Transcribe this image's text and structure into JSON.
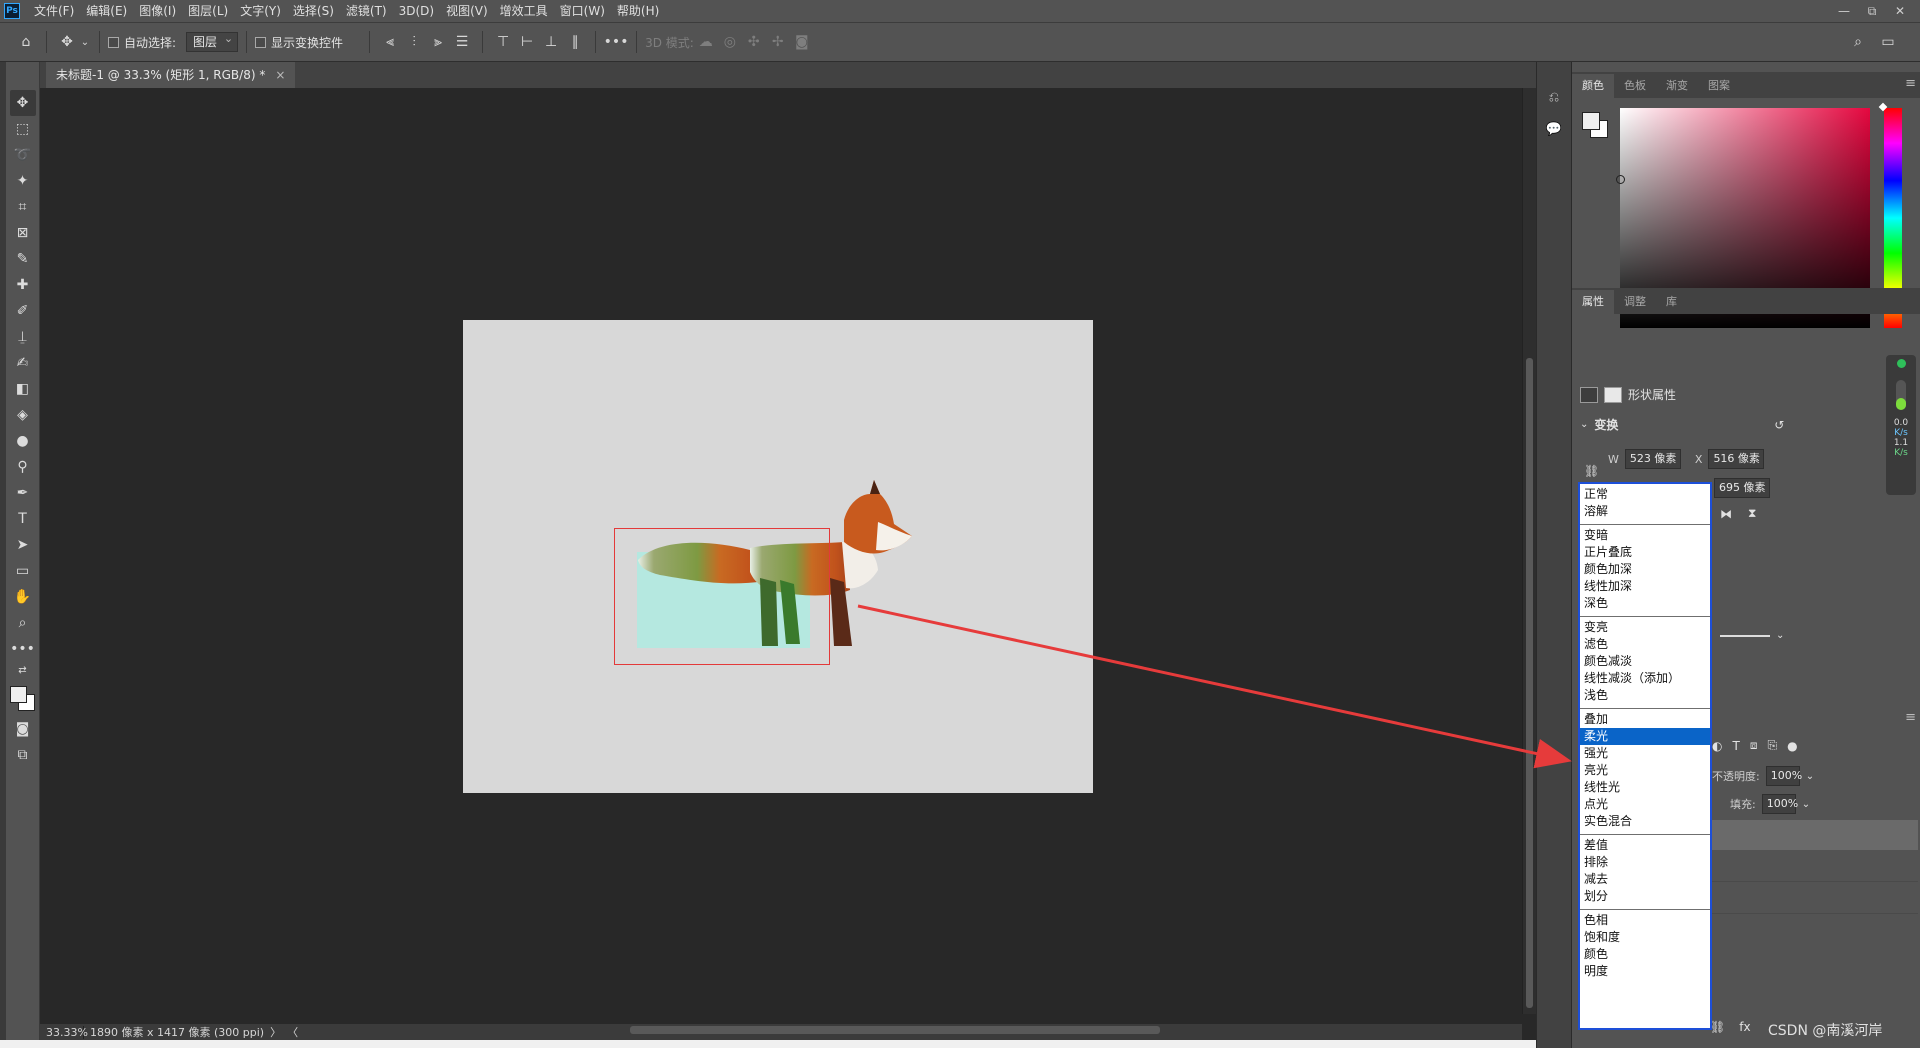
{
  "app": {
    "logo_text": "Ps"
  },
  "menubar": {
    "items": [
      "文件(F)",
      "编辑(E)",
      "图像(I)",
      "图层(L)",
      "文字(Y)",
      "选择(S)",
      "滤镜(T)",
      "3D(D)",
      "视图(V)",
      "增效工具",
      "窗口(W)",
      "帮助(H)"
    ],
    "window_controls": [
      "—",
      "⧉",
      "✕"
    ]
  },
  "options_bar": {
    "auto_select_label": "自动选择:",
    "auto_select_value": "图层",
    "show_transform_label": "显示变换控件",
    "mode_3d_label": "3D 模式:"
  },
  "document_tab": {
    "title": "未标题-1 @ 33.3% (矩形 1, RGB/8) *",
    "close": "×"
  },
  "status_bar": {
    "zoom": "33.33%",
    "doc_info": "1890 像素 x 1417 像素 (300 ppi)",
    "nav_right": "〉",
    "nav_left": "〈"
  },
  "color_panel": {
    "tabs": [
      "颜色",
      "色板",
      "渐变",
      "图案"
    ],
    "active_tab": 0,
    "foreground": "#efefef",
    "background": "#ffffff",
    "hue_color": "#e5073f"
  },
  "properties_panel": {
    "tabs": [
      "属性",
      "调整",
      "库"
    ],
    "active_tab": 0,
    "shape_props_label": "形状属性",
    "transform_header": "变换",
    "w_label": "W",
    "w_value": "523 像素",
    "x_label": "X",
    "x_value": "516 像素",
    "y_value": "695 像素"
  },
  "layers_panel": {
    "opacity_label": "不透明度:",
    "opacity_value": "100%",
    "fill_label": "填充:",
    "fill_value": "100%"
  },
  "blend_modes": {
    "selected": "柔光",
    "groups": [
      [
        "正常",
        "溶解"
      ],
      [
        "变暗",
        "正片叠底",
        "颜色加深",
        "线性加深",
        "深色"
      ],
      [
        "变亮",
        "滤色",
        "颜色减淡",
        "线性减淡（添加）",
        "浅色"
      ],
      [
        "叠加",
        "柔光",
        "强光",
        "亮光",
        "线性光",
        "点光",
        "实色混合"
      ],
      [
        "差值",
        "排除",
        "减去",
        "划分"
      ],
      [
        "色相",
        "饱和度",
        "颜色",
        "明度"
      ]
    ]
  },
  "net_widget": {
    "up_value": "0.0",
    "up_unit": "K/s",
    "down_value": "1.1",
    "down_unit": "K/s"
  },
  "watermark": "CSDN @南溪河岸"
}
